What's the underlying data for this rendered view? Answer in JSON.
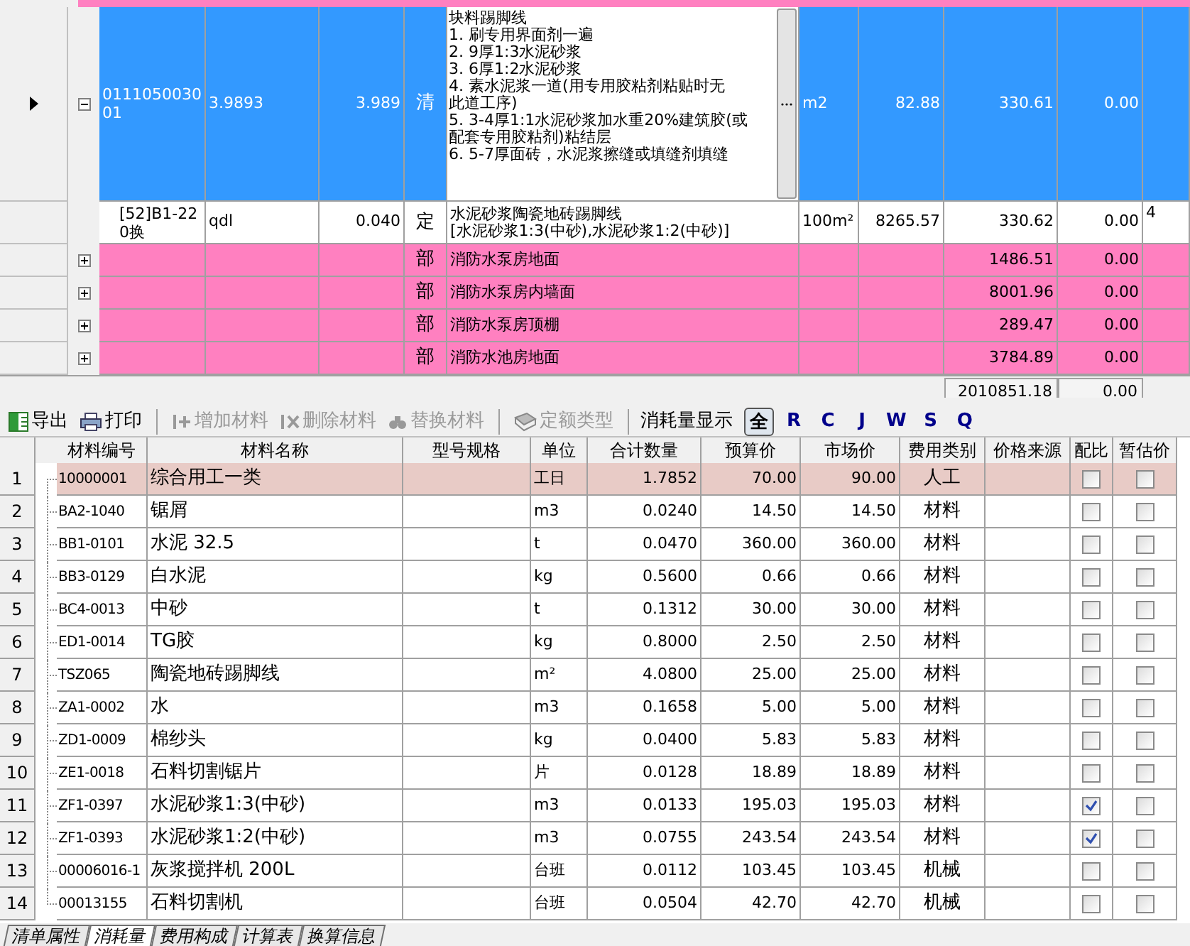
{
  "top_grid": {
    "rows": [
      {
        "kind": "item",
        "selected": true,
        "expanded": true,
        "code": "011105003001",
        "col_2": "3.9893",
        "col_3": "3.989",
        "type": "清",
        "description": [
          "块料踢脚线",
          "1. 刷专用界面剂一遍",
          "2. 9厚1:3水泥砂浆",
          "3. 6厚1:2水泥砂浆",
          "4. 素水泥浆一道(用专用胶粘剂粘贴时无",
          "此道工序)",
          "5. 3-4厚1:1水泥砂浆加水重20%建筑胶(或",
          "配套专用胶粘剂)粘结层",
          "6. 5-7厚面砖，水泥浆擦缝或填缝剂填缝"
        ],
        "unit": "m2",
        "price": "82.88",
        "total": "330.61",
        "col_9": "0.00"
      },
      {
        "kind": "quota",
        "selected": false,
        "code": "[52]B1-220换",
        "col_2": "qdl",
        "col_3": "0.040",
        "type": "定",
        "description": [
          "水泥砂浆陶瓷地砖踢脚线",
          "[水泥砂浆1:3(中砂),水泥砂浆1:2(中砂)]"
        ],
        "unit": "100m²",
        "price": "8265.57",
        "total": "330.62",
        "col_9": "0.00",
        "col_10": "4"
      },
      {
        "kind": "section",
        "selected": false,
        "expanded": false,
        "type": "部",
        "description": [
          "消防水泵房地面"
        ],
        "total": "1486.51",
        "col_9": "0.00"
      },
      {
        "kind": "section",
        "selected": false,
        "expanded": false,
        "type": "部",
        "description": [
          "消防水泵房内墙面"
        ],
        "total": "8001.96",
        "col_9": "0.00"
      },
      {
        "kind": "section",
        "selected": false,
        "expanded": false,
        "type": "部",
        "description": [
          "消防水泵房顶棚"
        ],
        "total": "289.47",
        "col_9": "0.00"
      },
      {
        "kind": "section",
        "selected": false,
        "expanded": false,
        "type": "部",
        "description": [
          "消防水池房地面"
        ],
        "total": "3784.89",
        "col_9": "0.00"
      }
    ],
    "totals": {
      "total": "2010851.18",
      "col_9": "0.00"
    }
  },
  "toolbar": {
    "buttons": [
      {
        "label": "导出",
        "disabled": false
      },
      {
        "label": "打印",
        "disabled": false
      },
      {
        "label": "增加材料",
        "disabled": true
      },
      {
        "label": "删除材料",
        "disabled": true
      },
      {
        "label": "替换材料",
        "disabled": true
      },
      {
        "label": "定额类型",
        "disabled": true
      }
    ],
    "filter_label": "消耗量显示",
    "filters": [
      {
        "label": "全",
        "selected": true
      },
      {
        "label": "R",
        "selected": false
      },
      {
        "label": "C",
        "selected": false
      },
      {
        "label": "J",
        "selected": false
      },
      {
        "label": "W",
        "selected": false
      },
      {
        "label": "S",
        "selected": false
      },
      {
        "label": "Q",
        "selected": false
      }
    ]
  },
  "materials": {
    "columns": [
      "材料编号",
      "材料名称",
      "型号规格",
      "单位",
      "合计数量",
      "预算价",
      "市场价",
      "费用类别",
      "价格来源",
      "配比",
      "暂估价"
    ],
    "rows": [
      {
        "num": "1",
        "code": "10000001",
        "name": "综合用工一类",
        "unit": "工日",
        "qty": "1.7852",
        "budget": "70.00",
        "market": "90.00",
        "category": "人工",
        "ratio": false,
        "estimate": false,
        "selected": true
      },
      {
        "num": "2",
        "code": "BA2-1040",
        "name": "锯屑",
        "unit": "m3",
        "qty": "0.0240",
        "budget": "14.50",
        "market": "14.50",
        "category": "材料",
        "ratio": false,
        "estimate": false,
        "selected": false
      },
      {
        "num": "3",
        "code": "BB1-0101",
        "name": "水泥 32.5",
        "unit": "t",
        "qty": "0.0470",
        "budget": "360.00",
        "market": "360.00",
        "category": "材料",
        "ratio": false,
        "estimate": false,
        "selected": false
      },
      {
        "num": "4",
        "code": "BB3-0129",
        "name": "白水泥",
        "unit": "kg",
        "qty": "0.5600",
        "budget": "0.66",
        "market": "0.66",
        "category": "材料",
        "ratio": false,
        "estimate": false,
        "selected": false
      },
      {
        "num": "5",
        "code": "BC4-0013",
        "name": "中砂",
        "unit": "t",
        "qty": "0.1312",
        "budget": "30.00",
        "market": "30.00",
        "category": "材料",
        "ratio": false,
        "estimate": false,
        "selected": false
      },
      {
        "num": "6",
        "code": "ED1-0014",
        "name": "TG胶",
        "unit": "kg",
        "qty": "0.8000",
        "budget": "2.50",
        "market": "2.50",
        "category": "材料",
        "ratio": false,
        "estimate": false,
        "selected": false
      },
      {
        "num": "7",
        "code": "TSZ065",
        "name": "陶瓷地砖踢脚线",
        "unit": "m²",
        "qty": "4.0800",
        "budget": "25.00",
        "market": "25.00",
        "category": "材料",
        "ratio": false,
        "estimate": false,
        "selected": false
      },
      {
        "num": "8",
        "code": "ZA1-0002",
        "name": "水",
        "unit": "m3",
        "qty": "0.1658",
        "budget": "5.00",
        "market": "5.00",
        "category": "材料",
        "ratio": false,
        "estimate": false,
        "selected": false
      },
      {
        "num": "9",
        "code": "ZD1-0009",
        "name": "棉纱头",
        "unit": "kg",
        "qty": "0.0400",
        "budget": "5.83",
        "market": "5.83",
        "category": "材料",
        "ratio": false,
        "estimate": false,
        "selected": false
      },
      {
        "num": "10",
        "code": "ZE1-0018",
        "name": "石料切割锯片",
        "unit": "片",
        "qty": "0.0128",
        "budget": "18.89",
        "market": "18.89",
        "category": "材料",
        "ratio": false,
        "estimate": false,
        "selected": false
      },
      {
        "num": "11",
        "code": "ZF1-0397",
        "name": "水泥砂浆1:3(中砂)",
        "unit": "m3",
        "qty": "0.0133",
        "budget": "195.03",
        "market": "195.03",
        "category": "材料",
        "ratio": true,
        "estimate": false,
        "selected": false
      },
      {
        "num": "12",
        "code": "ZF1-0393",
        "name": "水泥砂浆1:2(中砂)",
        "unit": "m3",
        "qty": "0.0755",
        "budget": "243.54",
        "market": "243.54",
        "category": "材料",
        "ratio": true,
        "estimate": false,
        "selected": false
      },
      {
        "num": "13",
        "code": "00006016-1",
        "name": "灰浆搅拌机 200L",
        "unit": "台班",
        "qty": "0.0112",
        "budget": "103.45",
        "market": "103.45",
        "category": "机械",
        "ratio": false,
        "estimate": false,
        "selected": false
      },
      {
        "num": "14",
        "code": "00013155",
        "name": "石料切割机",
        "unit": "台班",
        "qty": "0.0504",
        "budget": "42.70",
        "market": "42.70",
        "category": "机械",
        "ratio": false,
        "estimate": false,
        "selected": false
      }
    ]
  },
  "bottom_tabs": [
    {
      "label": "清单属性",
      "selected": false
    },
    {
      "label": "消耗量",
      "selected": true
    },
    {
      "label": "费用构成",
      "selected": false
    },
    {
      "label": "计算表",
      "selected": false
    },
    {
      "label": "换算信息",
      "selected": false
    }
  ]
}
